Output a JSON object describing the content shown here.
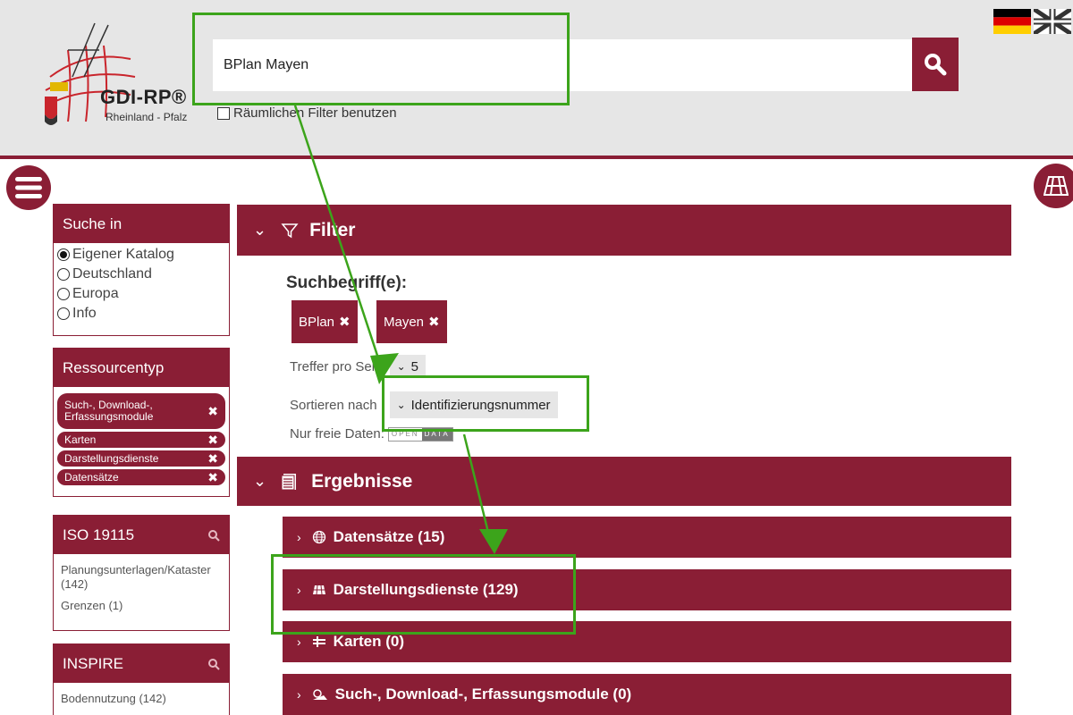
{
  "header": {
    "logo_text": "GDI-RP®",
    "logo_sub": "Rheinland - Pfalz",
    "search_value": "BPlan Mayen",
    "spatial_filter_label": "Räumlichen Filter benutzen"
  },
  "sidebar": {
    "search_in": {
      "title": "Suche in",
      "options": [
        "Eigener Katalog",
        "Deutschland",
        "Europa",
        "Info"
      ],
      "selected": "Eigener Katalog"
    },
    "resource_type": {
      "title": "Ressourcentyp",
      "items": [
        "Such-, Download-, Erfassungsmodule",
        "Karten",
        "Darstellungsdienste",
        "Datensätze"
      ]
    },
    "iso": {
      "title": "ISO 19115",
      "items": [
        "Planungsunterlagen/Kataster (142)",
        "Grenzen (1)"
      ]
    },
    "inspire": {
      "title": "INSPIRE",
      "items": [
        "Bodennutzung (142)"
      ]
    }
  },
  "filter": {
    "title": "Filter",
    "terms_label": "Suchbegriff(e):",
    "terms": [
      "BPlan",
      "Mayen"
    ],
    "hits_label": "Treffer pro Seite",
    "hits_value": "5",
    "sort_label": "Sortieren nach",
    "sort_value": "Identifizierungsnummer",
    "free_data_label": "Nur freie Daten:",
    "open_data_a": "OPEN",
    "open_data_b": "DATA"
  },
  "results": {
    "title": "Ergebnisse",
    "categories": [
      "Datensätze (15)",
      "Darstellungsdienste (129)",
      "Karten (0)",
      "Such-, Download-, Erfassungsmodule (0)"
    ]
  },
  "colors": {
    "brand": "#8a1e35",
    "annotation": "#3ca41b",
    "header_bg": "#e6e6e6"
  }
}
